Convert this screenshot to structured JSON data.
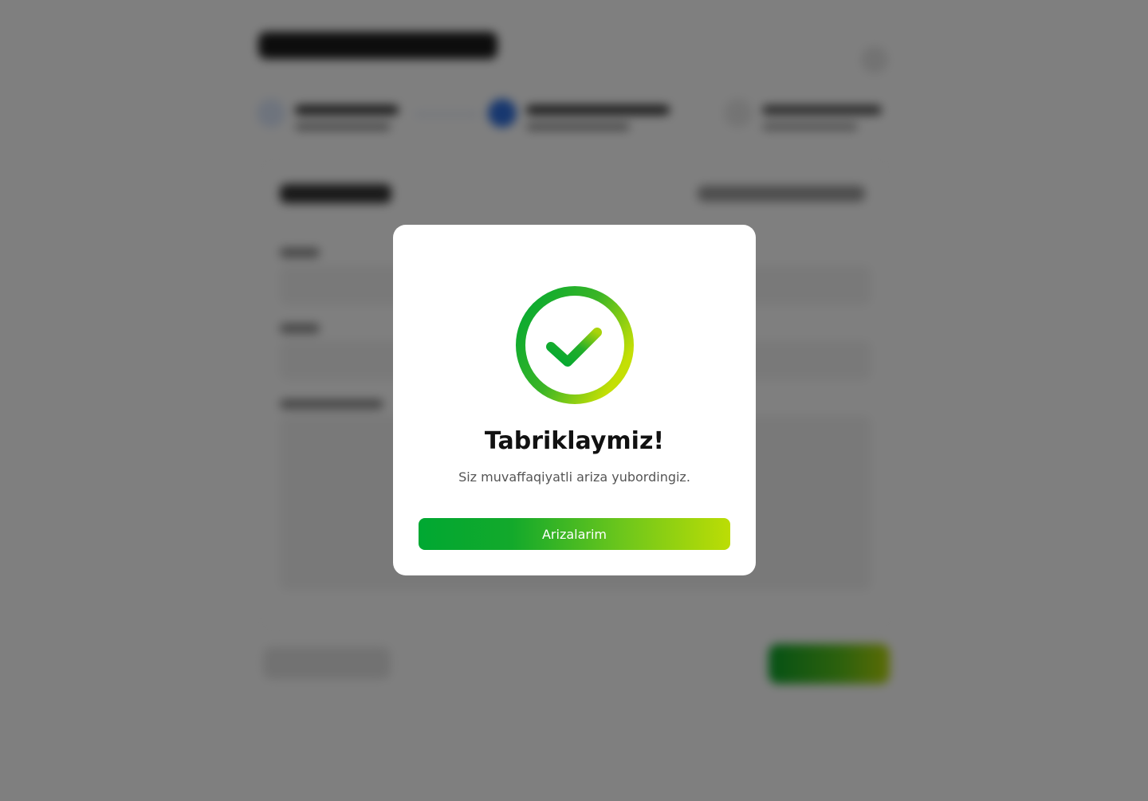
{
  "modal": {
    "title": "Tabriklaymiz!",
    "subtitle": "Siz muvaffaqiyatli ariza yubordingiz.",
    "button_label": "Arizalarim",
    "icon": "check-circle-icon"
  },
  "colors": {
    "accent_start": "#00a832",
    "accent_end": "#bcdd05",
    "overlay": "rgba(0,0,0,0.5)",
    "step_active": "#2f6fde"
  }
}
